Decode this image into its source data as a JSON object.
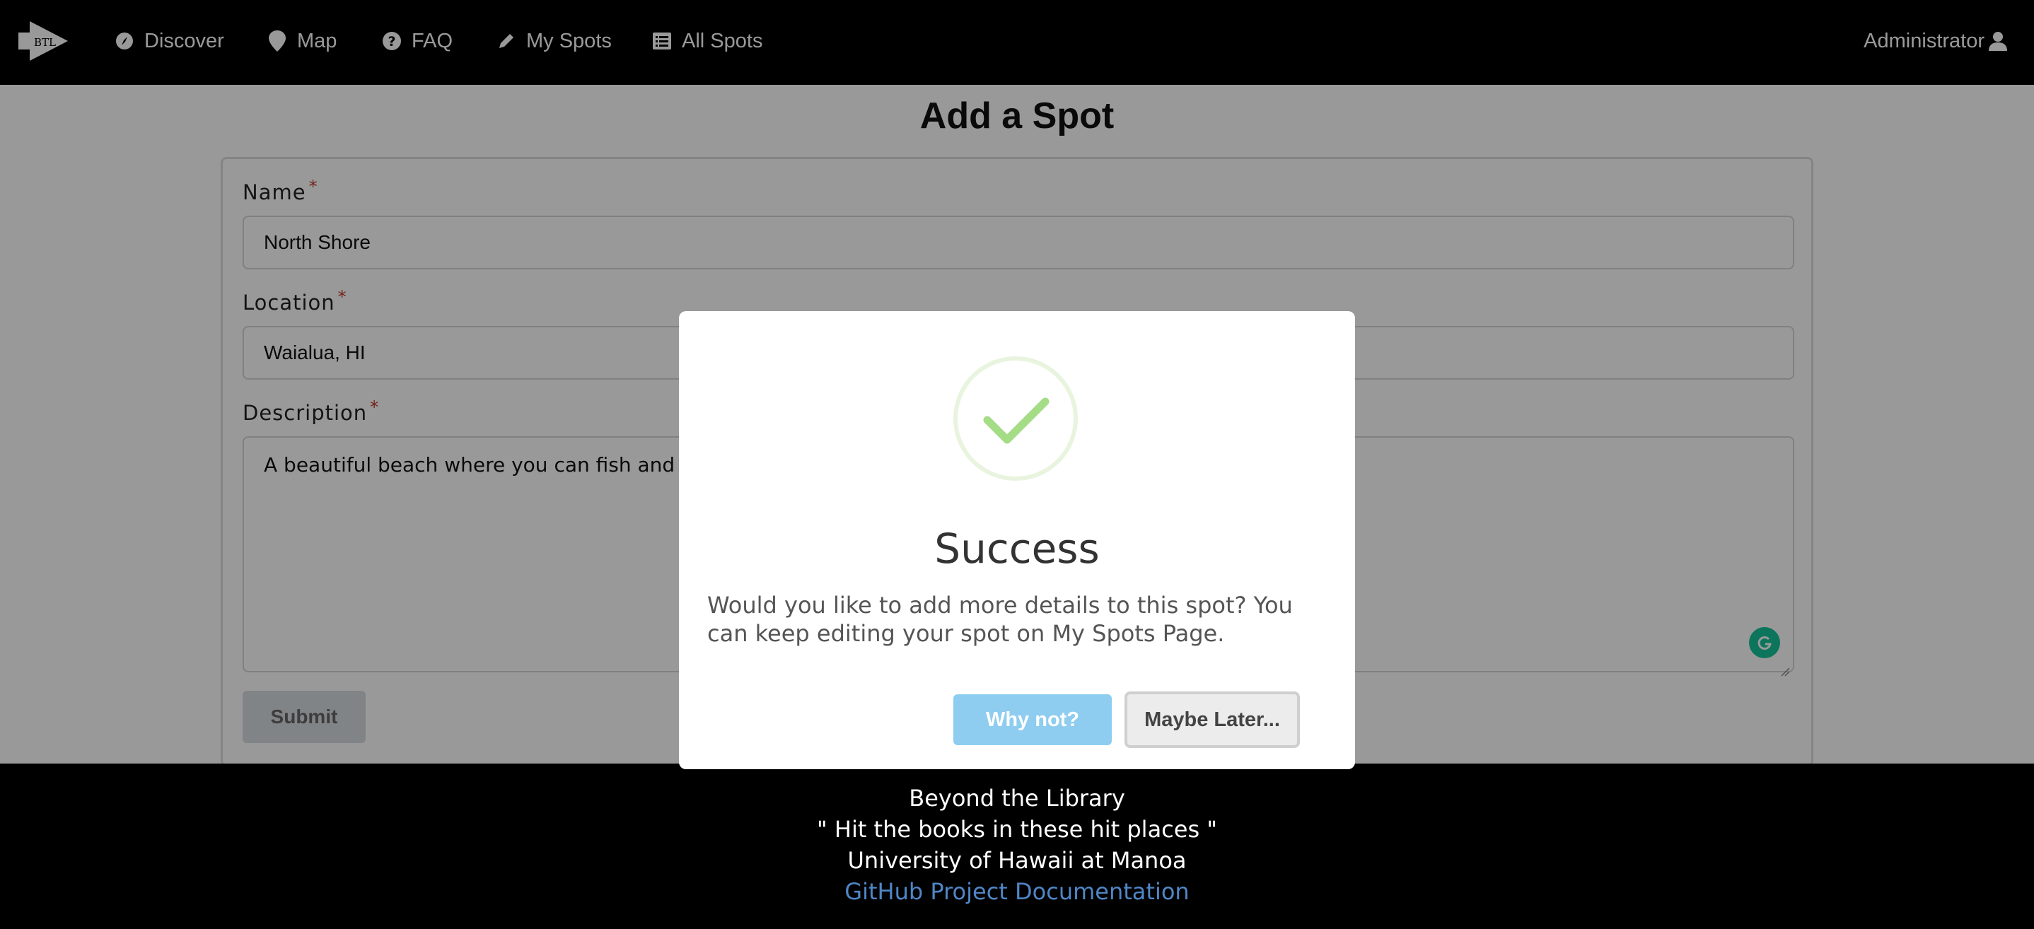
{
  "navbar": {
    "logo_text": "BTL",
    "items": [
      {
        "label": "Discover",
        "icon": "compass-icon"
      },
      {
        "label": "Map",
        "icon": "map-marker-icon"
      },
      {
        "label": "FAQ",
        "icon": "question-circle-icon"
      },
      {
        "label": "My Spots",
        "icon": "pencil-icon"
      },
      {
        "label": "All Spots",
        "icon": "list-icon"
      }
    ],
    "user_label": "Administrator",
    "user_icon": "user-icon"
  },
  "page": {
    "title": "Add a Spot"
  },
  "form": {
    "name_label": "Name",
    "name_value": "North Shore",
    "location_label": "Location",
    "location_value": "Waialua, HI",
    "description_label": "Description",
    "description_value": "A beautiful beach where you can fish and read y",
    "required_mark": "*",
    "submit_label": "Submit"
  },
  "modal": {
    "title": "Success",
    "message": "Would you like to add more details to this spot? You can keep editing your spot on My Spots Page.",
    "confirm_label": "Why not?",
    "cancel_label": "Maybe Later..."
  },
  "footer": {
    "line1": "Beyond the Library",
    "line2": "\" Hit the books in these hit places \"",
    "line3": "University of Hawaii at Manoa",
    "link_label": "GitHub Project Documentation"
  },
  "colors": {
    "navbar_bg": "#000000",
    "accent_check": "#a5dc86",
    "confirm_button": "#8ecdf0",
    "required": "#c0392b",
    "link": "#4f86c6"
  }
}
